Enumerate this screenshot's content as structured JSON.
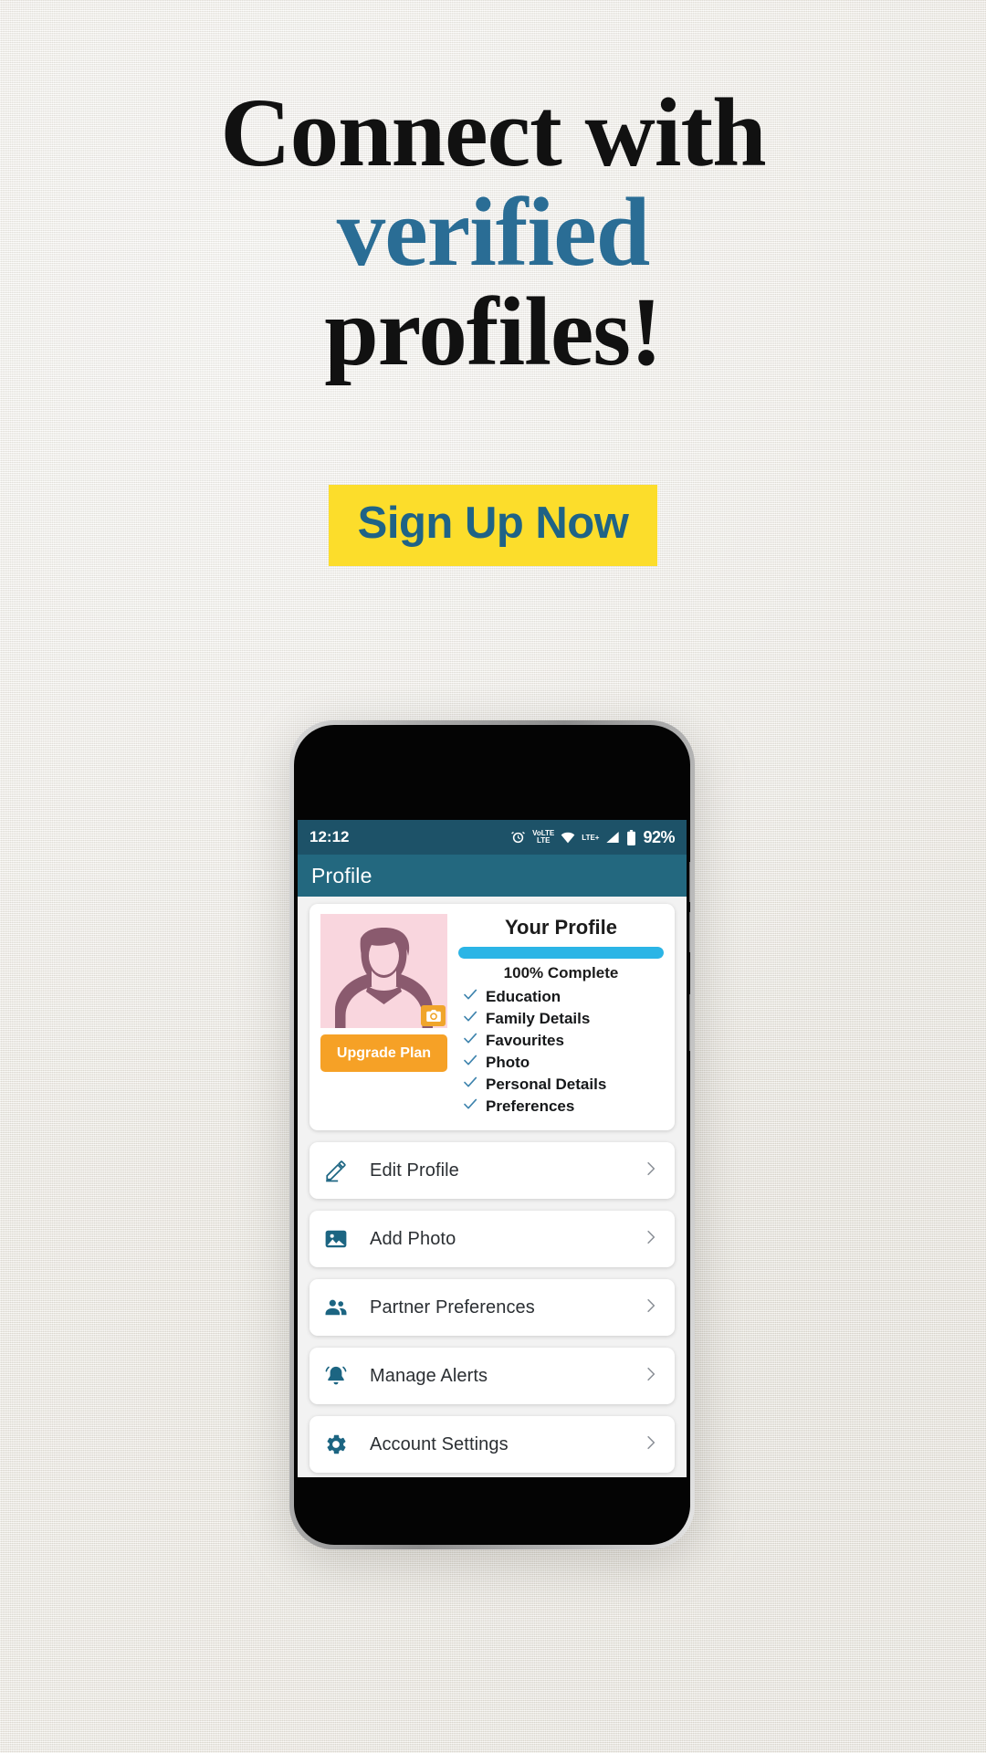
{
  "poster": {
    "background_color": "#efece5",
    "headline": {
      "line1": "Connect with",
      "line2": "verified",
      "line3": "profiles!",
      "accent_color": "#2a6d95",
      "text_color": "#111111"
    },
    "cta": {
      "label": "Sign Up Now",
      "background_color": "#fcdd2b",
      "text_color": "#1f6386"
    }
  },
  "phone": {
    "status_bar": {
      "time": "12:12",
      "alarm_icon": "alarm-clock-icon",
      "volte_label_top": "VoLTE",
      "volte_label": "LTE",
      "wifi_icon": "wifi-icon",
      "network_label": "LTE+",
      "signal_icon": "signal-bars-icon",
      "battery_icon": "battery-icon",
      "battery_percent": "92%",
      "background_color": "#1d5268"
    },
    "app_bar": {
      "title": "Profile",
      "background_color": "#23687f"
    },
    "profile_card": {
      "avatar_icon": "person-avatar-icon",
      "avatar_background": "#f9d6de",
      "camera_badge_icon": "camera-icon",
      "upgrade_button_label": "Upgrade Plan",
      "upgrade_button_color": "#f6a126",
      "title": "Your Profile",
      "progress_percent": 100,
      "progress_color": "#2bb5e6",
      "progress_label": "100% Complete",
      "checklist": [
        {
          "label": "Education",
          "checked": true
        },
        {
          "label": "Family Details",
          "checked": true
        },
        {
          "label": "Favourites",
          "checked": true
        },
        {
          "label": "Photo",
          "checked": true
        },
        {
          "label": "Personal Details",
          "checked": true
        },
        {
          "label": "Preferences",
          "checked": true
        }
      ],
      "check_color": "#3d83ad"
    },
    "menu": [
      {
        "label": "Edit Profile",
        "icon": "pencil-edit-icon",
        "chevron": "chevron-right-icon"
      },
      {
        "label": "Add Photo",
        "icon": "image-photo-icon",
        "chevron": "chevron-right-icon"
      },
      {
        "label": "Partner Preferences",
        "icon": "people-group-icon",
        "chevron": "chevron-right-icon"
      },
      {
        "label": "Manage Alerts",
        "icon": "bell-alert-icon",
        "chevron": "chevron-right-icon"
      },
      {
        "label": "Account Settings",
        "icon": "gear-settings-icon",
        "chevron": "chevron-right-icon"
      }
    ],
    "menu_icon_color": "#1c6582"
  }
}
